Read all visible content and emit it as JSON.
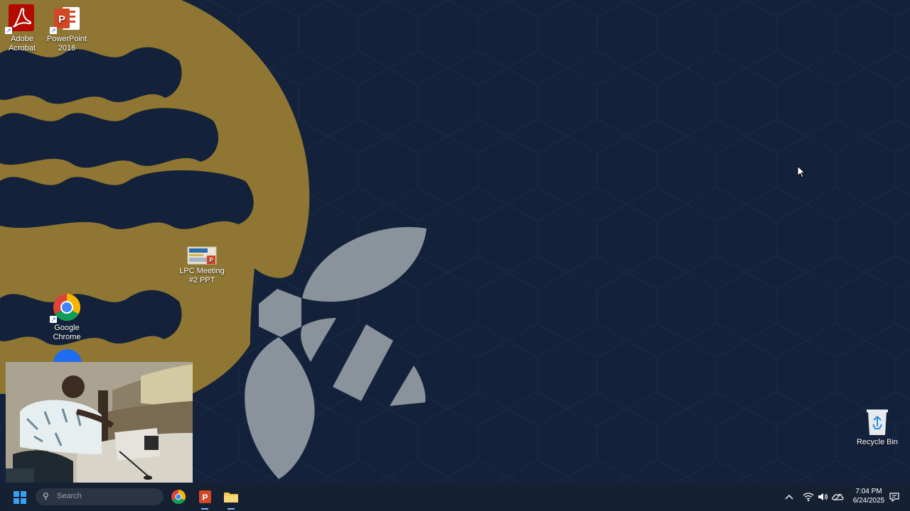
{
  "desktop": {
    "icons": [
      {
        "label": "Adobe Acrobat",
        "icon": "adobe-acrobat-icon",
        "color": "#b30b00"
      },
      {
        "label": "PowerPoint 2016",
        "icon": "powerpoint-icon",
        "color": "#d24726"
      },
      {
        "label": "LPC Meeting #2 PPT",
        "icon": "pptx-file-icon"
      },
      {
        "label": "Google Chrome",
        "icon": "chrome-icon"
      },
      {
        "label": "Recycle Bin",
        "icon": "recycle-bin-icon"
      }
    ]
  },
  "taskbar": {
    "search_placeholder": "Search",
    "clock": {
      "time": "7:04 PM",
      "date": "6/24/2025"
    }
  },
  "colors": {
    "desktop_bg": "#13223a",
    "wallpaper_gold": "#8f7733",
    "wallpaper_gray": "#8a939b",
    "taskbar_bg": "#152133"
  }
}
